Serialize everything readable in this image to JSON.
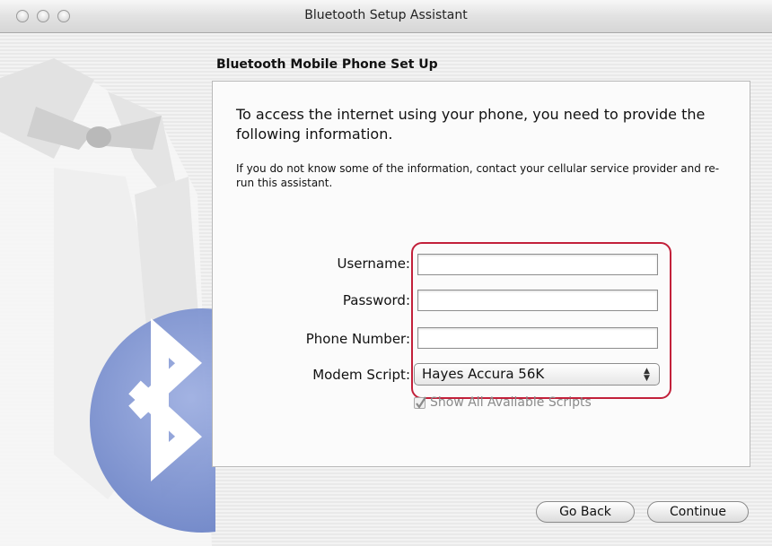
{
  "window": {
    "title": "Bluetooth Setup Assistant"
  },
  "section_title": "Bluetooth Mobile Phone Set Up",
  "intro_text": "To access the internet using your phone, you need to provide the following information.",
  "note_text": "If you do not know some of the information, contact your cellular service provider and re-run this assistant.",
  "form": {
    "username_label": "Username:",
    "username_value": "",
    "password_label": "Password:",
    "password_value": "",
    "phone_label": "Phone Number:",
    "phone_value": "",
    "modem_label": "Modem Script:",
    "modem_selected": "Hayes Accura 56K",
    "show_all_label": "Show All Available Scripts",
    "show_all_checked": true
  },
  "buttons": {
    "back": "Go Back",
    "continue": "Continue"
  },
  "colors": {
    "highlight": "#c2203a",
    "bluetooth_blue": "#6f86c8"
  },
  "icons": [
    "window-close-icon",
    "window-minimize-icon",
    "window-zoom-icon",
    "bluetooth-icon",
    "tuxedo-illustration",
    "checkmark-icon",
    "updown-arrows-icon"
  ]
}
